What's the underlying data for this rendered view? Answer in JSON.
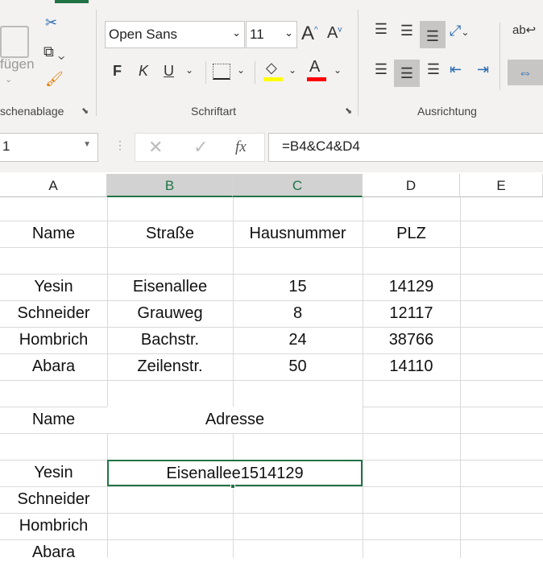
{
  "ribbon": {
    "clipboard": {
      "paste_label": "fügen",
      "group_label": "schenablage"
    },
    "font": {
      "family": "Open Sans",
      "size": "11",
      "bold": "F",
      "italic": "K",
      "underline": "U",
      "group_label": "Schriftart",
      "fill_color": "#ffff00",
      "font_color": "#ff0000"
    },
    "alignment": {
      "group_label": "Ausrichtung"
    }
  },
  "formula_bar": {
    "name_box": "1",
    "fx": "fx",
    "formula": "=B4&C4&D4"
  },
  "columns": [
    "A",
    "B",
    "C",
    "D",
    "E"
  ],
  "table1": {
    "headers": [
      "Name",
      "Straße",
      "Hausnummer",
      "PLZ"
    ],
    "rows": [
      [
        "Yesin",
        "Eisenallee",
        "15",
        "14129"
      ],
      [
        "Schneider",
        "Grauweg",
        "8",
        "12117"
      ],
      [
        "Hombrich",
        "Bachstr.",
        "24",
        "38766"
      ],
      [
        "Abara",
        "Zeilenstr.",
        "50",
        "14110"
      ]
    ]
  },
  "table2": {
    "headers": [
      "Name",
      "Adresse"
    ],
    "names": [
      "Yesin",
      "Schneider",
      "Hombrich",
      "Abara"
    ],
    "results": [
      "Eisenallee1514129"
    ]
  }
}
